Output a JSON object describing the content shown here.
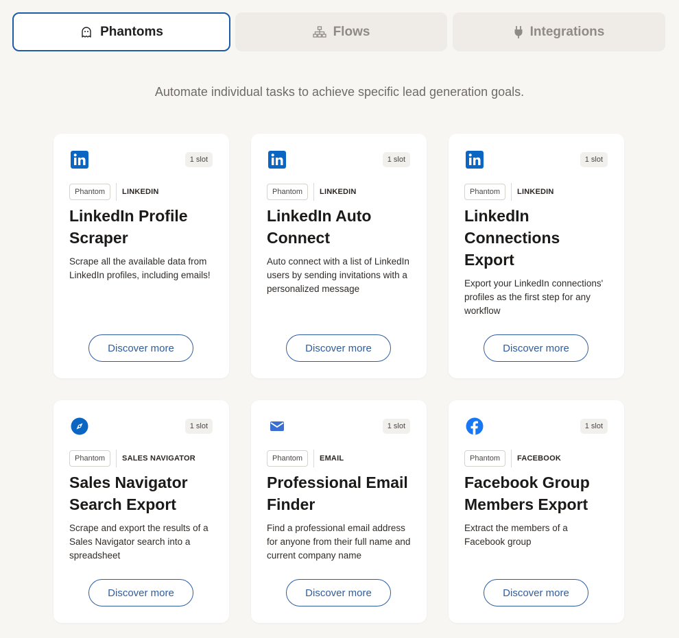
{
  "tabs": [
    {
      "label": "Phantoms",
      "icon": "ghost-icon",
      "active": true
    },
    {
      "label": "Flows",
      "icon": "flow-diagram-icon",
      "active": false
    },
    {
      "label": "Integrations",
      "icon": "plug-icon",
      "active": false
    }
  ],
  "subtitle": "Automate individual tasks to achieve specific lead generation goals.",
  "cards": [
    {
      "icon": "linkedin-icon",
      "slot": "1 slot",
      "type": "Phantom",
      "platform": "LINKEDIN",
      "title": "LinkedIn Profile Scraper",
      "description": "Scrape all the available data from LinkedIn profiles, including emails!",
      "button": "Discover more"
    },
    {
      "icon": "linkedin-icon",
      "slot": "1 slot",
      "type": "Phantom",
      "platform": "LINKEDIN",
      "title": "LinkedIn Auto Connect",
      "description": "Auto connect with a list of LinkedIn users by sending invitations with a personalized message",
      "button": "Discover more"
    },
    {
      "icon": "linkedin-icon",
      "slot": "1 slot",
      "type": "Phantom",
      "platform": "LINKEDIN",
      "title": "LinkedIn Connections Export",
      "description": "Export your LinkedIn connections' profiles as the first step for any workflow",
      "button": "Discover more"
    },
    {
      "icon": "compass-icon",
      "slot": "1 slot",
      "type": "Phantom",
      "platform": "SALES NAVIGATOR",
      "title": "Sales Navigator Search Export",
      "description": "Scrape and export the results of a Sales Navigator search into a spreadsheet",
      "button": "Discover more"
    },
    {
      "icon": "envelope-icon",
      "slot": "1 slot",
      "type": "Phantom",
      "platform": "EMAIL",
      "title": "Professional Email Finder",
      "description": "Find a professional email address for anyone from their full name and current company name",
      "button": "Discover more"
    },
    {
      "icon": "facebook-icon",
      "slot": "1 slot",
      "type": "Phantom",
      "platform": "FACEBOOK",
      "title": "Facebook Group Members Export",
      "description": "Extract the members of a Facebook group",
      "button": "Discover more"
    }
  ],
  "colors": {
    "accent": "#1e5aa8",
    "linkedin": "#0a66c2",
    "facebook": "#1877f2",
    "email": "#3b6fd1"
  }
}
